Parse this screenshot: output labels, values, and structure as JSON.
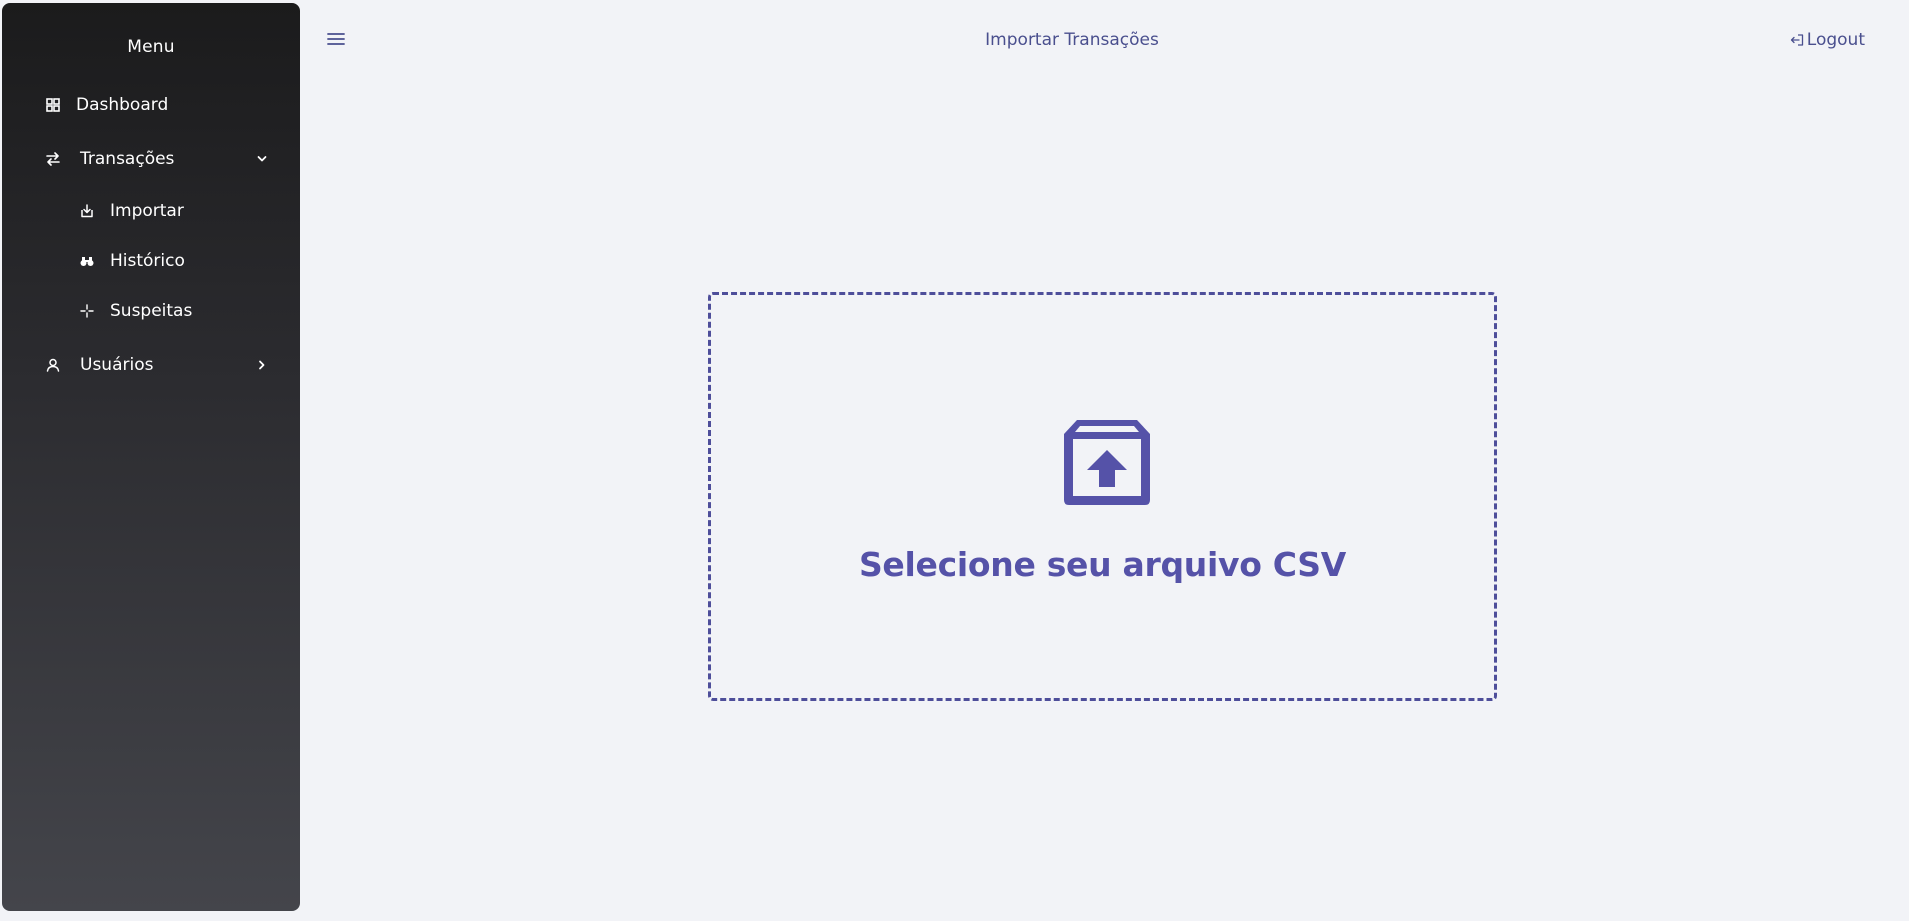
{
  "sidebar": {
    "title": "Menu",
    "items": [
      {
        "label": "Dashboard",
        "icon": "grid-icon"
      },
      {
        "label": "Transações",
        "icon": "arrows-swap-icon",
        "expanded": true,
        "children": [
          {
            "label": "Importar",
            "icon": "download-tray-icon"
          },
          {
            "label": "Histórico",
            "icon": "binoculars-icon"
          },
          {
            "label": "Suspeitas",
            "icon": "crosshair-icon"
          }
        ]
      },
      {
        "label": "Usuários",
        "icon": "user-icon",
        "expanded": false
      }
    ]
  },
  "header": {
    "title": "Importar Transações",
    "logout_label": "Logout",
    "menu_icon": "hamburger-icon"
  },
  "main": {
    "dropzone_text": "Selecione seu arquivo CSV",
    "dropzone_icon": "archive-upload-icon"
  },
  "colors": {
    "accent": "#5552a8",
    "text_header": "#4a4f8e",
    "background": "#f2f3f7",
    "sidebar_top": "#1b1b1c",
    "sidebar_bottom": "#44454b"
  }
}
